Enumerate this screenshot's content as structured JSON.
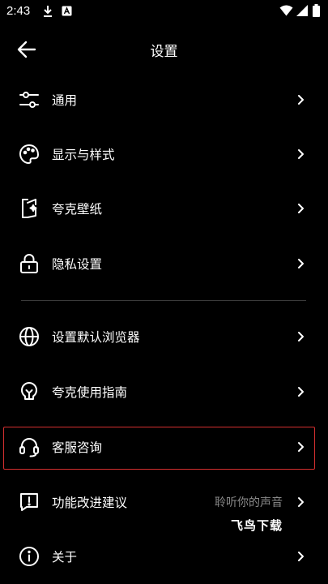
{
  "status_bar": {
    "time": "2:43"
  },
  "header": {
    "title": "设置"
  },
  "menu": [
    {
      "id": "general",
      "label": "通用",
      "icon": "sliders-icon"
    },
    {
      "id": "display",
      "label": "显示与样式",
      "icon": "palette-icon"
    },
    {
      "id": "wallpaper",
      "label": "夸克壁纸",
      "icon": "wallpaper-icon"
    },
    {
      "id": "privacy",
      "label": "隐私设置",
      "icon": "lock-icon"
    },
    {
      "id": "default-browser",
      "label": "设置默认浏览器",
      "icon": "globe-icon"
    },
    {
      "id": "guide",
      "label": "夸克使用指南",
      "icon": "bulb-icon"
    },
    {
      "id": "support",
      "label": "客服咨询",
      "icon": "headset-icon"
    },
    {
      "id": "feedback",
      "label": "功能改进建议",
      "value": "聆听你的声音",
      "icon": "feedback-icon"
    },
    {
      "id": "about",
      "label": "关于",
      "icon": "info-icon"
    }
  ],
  "watermark": "飞鸟下载"
}
